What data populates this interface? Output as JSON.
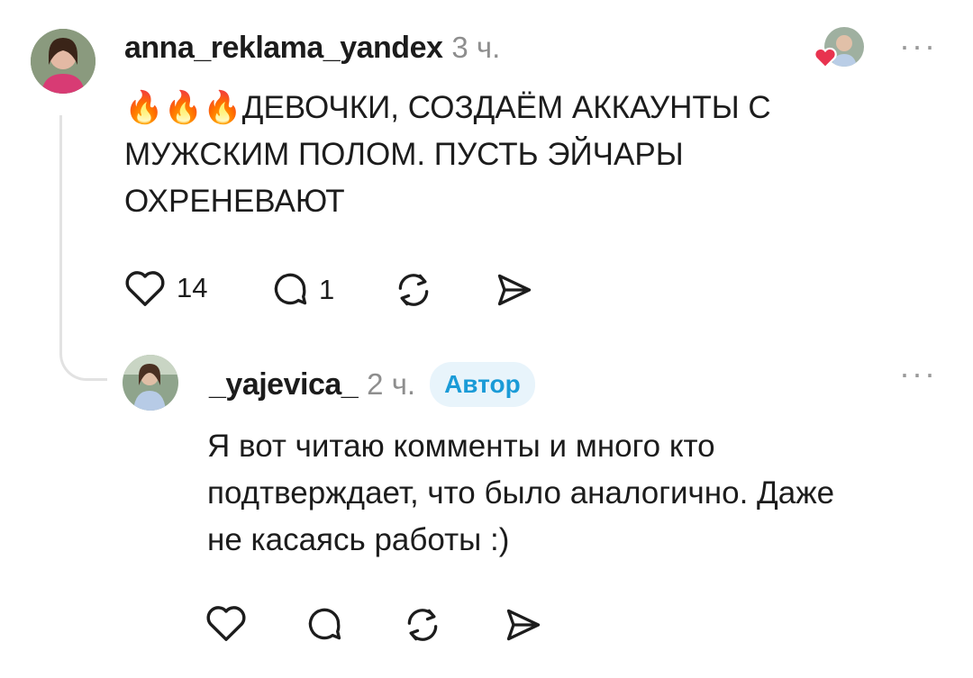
{
  "comments": [
    {
      "username": "anna_reklama_yandex",
      "time": "3 ч.",
      "text_line1": "🔥🔥🔥ДЕВОЧКИ, СОЗДАЁМ АККАУНТЫ С",
      "text_line2": "МУЖСКИМ ПОЛОМ. ПУСТЬ ЭЙЧАРЫ",
      "text_line3": "ОХРЕНЕВАЮТ",
      "likes": "14",
      "replies": "1",
      "more": "···"
    },
    {
      "username": "_yajevica_",
      "time": "2 ч.",
      "badge": "Автор",
      "text_line1": "Я вот читаю комменты и много кто",
      "text_line2": "подтверждает, что было аналогично. Даже",
      "text_line3": "не касаясь работы :)",
      "more": "···"
    }
  ],
  "icons": [
    "heart-icon",
    "comment-icon",
    "repost-icon",
    "share-icon",
    "more-icon"
  ],
  "colors": {
    "badge_text": "#1a9bd7",
    "badge_bg": "#e8f4fb",
    "liked_heart": "#e8334f"
  }
}
